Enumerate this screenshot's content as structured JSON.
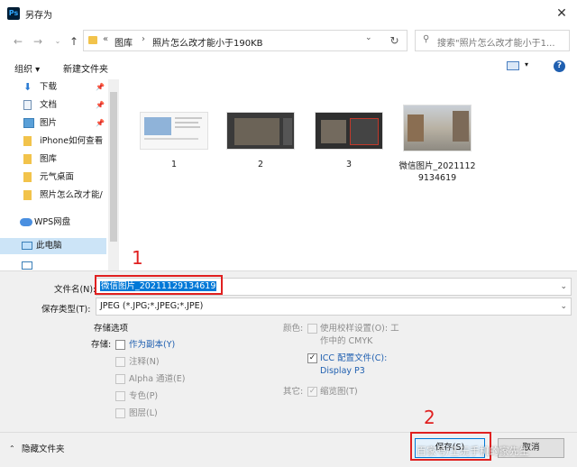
{
  "window": {
    "title": "另存为",
    "app_icon": "Ps",
    "close_label": "✕"
  },
  "nav": {
    "path_root_glyph": "«",
    "path": [
      "图库",
      "照片怎么改才能小于190KB"
    ],
    "search_placeholder": "搜索\"照片怎么改才能小于1..."
  },
  "toolbar": {
    "organize_label": "组织 ▾",
    "new_folder_label": "新建文件夹"
  },
  "sidebar": {
    "items": [
      {
        "label": "下载",
        "icon": "download-icon",
        "pinned": true
      },
      {
        "label": "文档",
        "icon": "document-icon",
        "pinned": true
      },
      {
        "label": "图片",
        "icon": "pictures-icon",
        "pinned": true
      },
      {
        "label": "iPhone如何查看",
        "icon": "folder-icon",
        "pinned": false
      },
      {
        "label": "图库",
        "icon": "folder-icon",
        "pinned": false
      },
      {
        "label": "元气桌面",
        "icon": "folder-icon",
        "pinned": false
      },
      {
        "label": "照片怎么改才能/",
        "icon": "folder-icon",
        "pinned": false
      },
      {
        "label": "WPS网盘",
        "icon": "cloud-icon",
        "pinned": false
      },
      {
        "label": "此电脑",
        "icon": "computer-icon",
        "pinned": false,
        "selected": true
      },
      {
        "label": "",
        "icon": "network-icon",
        "pinned": false
      }
    ]
  },
  "files": [
    {
      "name": "1"
    },
    {
      "name": "2"
    },
    {
      "name": "3"
    },
    {
      "name": "微信图片_20211129134619"
    }
  ],
  "form": {
    "filename_label": "文件名(N):",
    "filename_value": "微信图片_20211129134619",
    "filetype_label": "保存类型(T):",
    "filetype_value": "JPEG (*.JPG;*.JPEG;*.JPE)",
    "save_options_title": "存储选项",
    "storage_label": "存储:",
    "as_copy": "作为副本(Y)",
    "notes": "注释(N)",
    "alpha": "Alpha 通道(E)",
    "spot": "专色(P)",
    "layers": "图层(L)",
    "color_label": "颜色:",
    "use_proof_line1": "使用校样设置(O): 工",
    "use_proof_line2": "作中的 CMYK",
    "icc_line1": "ICC 配置文件(C):",
    "icc_line2": "Display P3",
    "other_label": "其它:",
    "thumbnail": "缩览图(T)"
  },
  "footer": {
    "hide_folders": "隐藏文件夹",
    "save_button": "保存(S)",
    "cancel_button": "取消"
  },
  "annotations": {
    "marker1": "1",
    "marker2": "2"
  },
  "watermark": "百家号/王玩手机的家先生",
  "colors": {
    "annotation_red": "#e02020",
    "selection_blue": "#0078d7",
    "link_blue": "#1f5fb0"
  }
}
